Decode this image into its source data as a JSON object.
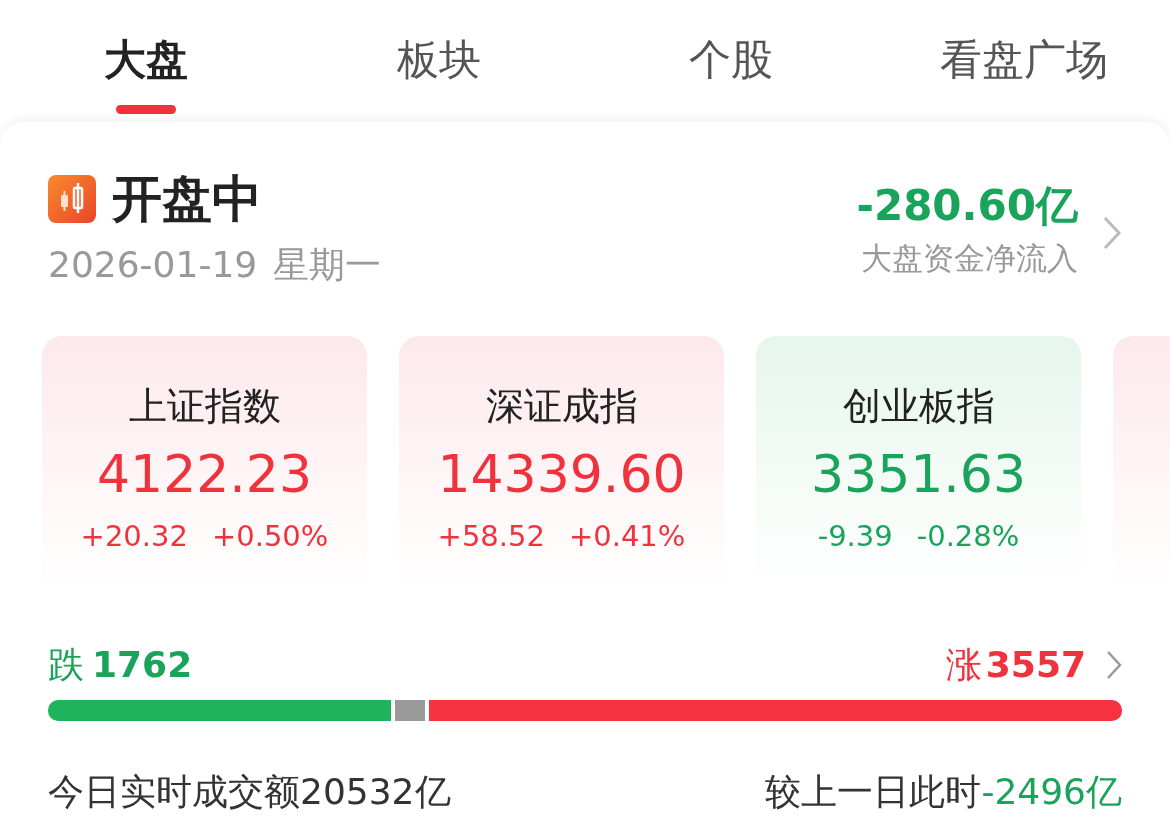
{
  "tabs": [
    {
      "label": "大盘",
      "selected": true
    },
    {
      "label": "板块",
      "selected": false
    },
    {
      "label": "个股",
      "selected": false
    },
    {
      "label": "看盘广场",
      "selected": false
    }
  ],
  "status": {
    "title": "开盘中",
    "date": "2026-01-19",
    "weekday": "星期一"
  },
  "fund_flow": {
    "value": "-280.60亿",
    "label": "大盘资金净流入",
    "rising": false
  },
  "indices": [
    {
      "name": "上证指数",
      "value": "4122.23",
      "change": "+20.32",
      "percent": "+0.50%",
      "rising": true
    },
    {
      "name": "深证成指",
      "value": "14339.60",
      "change": "+58.52",
      "percent": "+0.41%",
      "rising": true
    },
    {
      "name": "创业板指",
      "value": "3351.63",
      "change": "-9.39",
      "percent": "-0.28%",
      "rising": false
    },
    {
      "rising": true
    }
  ],
  "breadth": {
    "fall_label": "跌",
    "fall_count": "1762",
    "rise_label": "涨",
    "rise_count": "3557"
  },
  "turnover": {
    "label": "今日实时成交额",
    "value": "20532亿",
    "compare_label": "较上一日此时",
    "compare_value": "-2496亿",
    "compare_rising": false
  }
}
